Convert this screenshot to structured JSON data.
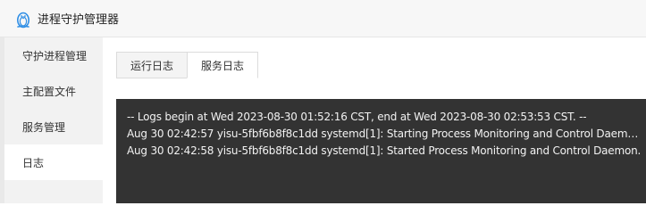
{
  "window": {
    "title": "进程守护管理器",
    "icon": "penguin-icon"
  },
  "sidebar": {
    "items": [
      {
        "label": "守护进程管理",
        "active": false
      },
      {
        "label": "主配置文件",
        "active": false
      },
      {
        "label": "服务管理",
        "active": false
      },
      {
        "label": "日志",
        "active": true
      }
    ]
  },
  "main": {
    "tabs": [
      {
        "label": "运行日志",
        "active": false
      },
      {
        "label": "服务日志",
        "active": true
      }
    ],
    "log_lines": [
      "-- Logs begin at Wed 2023-08-30 01:52:16 CST, end at Wed 2023-08-30 02:53:53 CST. --",
      "Aug 30 02:42:57 yisu-5fbf6b8f8c1dd systemd[1]: Starting Process Monitoring and Control Daemon...",
      "Aug 30 02:42:58 yisu-5fbf6b8f8c1dd systemd[1]: Started Process Monitoring and Control Daemon."
    ]
  },
  "colors": {
    "log_background": "#333333",
    "log_text": "#f2f2f2",
    "sidebar_background": "#f2f2f2",
    "icon_blue": "#2f8ee5"
  }
}
